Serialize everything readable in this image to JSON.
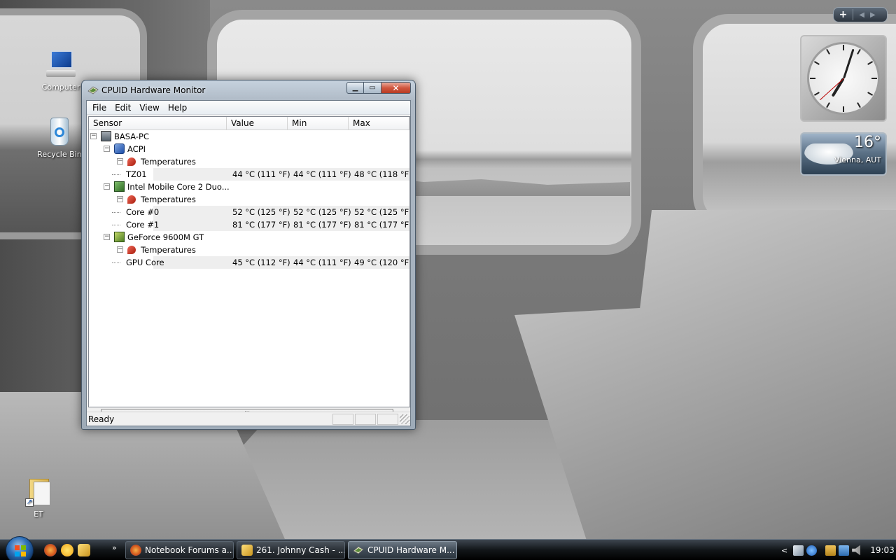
{
  "desktop": {
    "icons": [
      {
        "label": "Computer",
        "icon": "computer-icon"
      },
      {
        "label": "Recycle Bin",
        "icon": "recycle-bin-icon"
      },
      {
        "label": "ET",
        "icon": "folder-shortcut-icon"
      }
    ]
  },
  "gadgets": {
    "clock": {
      "hour": 7,
      "minute": 3,
      "second": 38
    },
    "weather": {
      "temperature": "16°",
      "location": "Vienna, AUT"
    }
  },
  "window": {
    "title": "CPUID Hardware Monitor",
    "menu": [
      "File",
      "Edit",
      "View",
      "Help"
    ],
    "columns": [
      "Sensor",
      "Value",
      "Min",
      "Max"
    ],
    "tree": [
      {
        "level": 0,
        "label": "BASA-PC",
        "icon": "pc",
        "value": "",
        "min": "",
        "max": ""
      },
      {
        "level": 1,
        "label": "ACPI",
        "icon": "acpi",
        "value": "",
        "min": "",
        "max": ""
      },
      {
        "level": 2,
        "label": "Temperatures",
        "icon": "temp",
        "value": "",
        "min": "",
        "max": ""
      },
      {
        "level": 3,
        "label": "TZ01",
        "icon": "",
        "value": "44 °C  (111 °F)",
        "min": "44 °C  (111 °F)",
        "max": "48 °C  (118 °F)"
      },
      {
        "level": 1,
        "label": "Intel Mobile Core 2 Duo...",
        "icon": "cpu",
        "value": "",
        "min": "",
        "max": ""
      },
      {
        "level": 2,
        "label": "Temperatures",
        "icon": "temp",
        "value": "",
        "min": "",
        "max": ""
      },
      {
        "level": 3,
        "label": "Core #0",
        "icon": "",
        "value": "52 °C  (125 °F)",
        "min": "52 °C  (125 °F)",
        "max": "52 °C  (125 °F)"
      },
      {
        "level": 3,
        "label": "Core #1",
        "icon": "",
        "value": "81 °C  (177 °F)",
        "min": "81 °C  (177 °F)",
        "max": "81 °C  (177 °F)"
      },
      {
        "level": 1,
        "label": "GeForce 9600M GT",
        "icon": "gpu",
        "value": "",
        "min": "",
        "max": ""
      },
      {
        "level": 2,
        "label": "Temperatures",
        "icon": "temp",
        "value": "",
        "min": "",
        "max": ""
      },
      {
        "level": 3,
        "label": "GPU Core",
        "icon": "",
        "value": "45 °C  (112 °F)",
        "min": "44 °C  (111 °F)",
        "max": "49 °C  (120 °F)"
      }
    ],
    "status": "Ready"
  },
  "taskbar": {
    "quick_launch": [
      "firefox-icon",
      "messenger-icon",
      "tool-icon"
    ],
    "more": "»",
    "tasks": [
      {
        "label": "Notebook Forums a...",
        "icon": "firefox-icon",
        "active": false
      },
      {
        "label": "261. Johnny Cash - ...",
        "icon": "tool-icon",
        "active": false
      },
      {
        "label": "CPUID Hardware M...",
        "icon": "cpuid-icon",
        "active": true
      }
    ],
    "tray_chevron": "<",
    "time": "19:03"
  }
}
